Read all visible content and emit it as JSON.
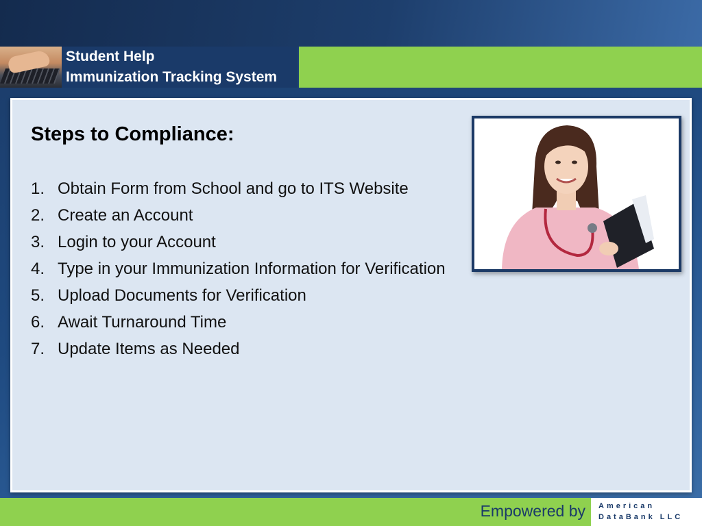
{
  "header": {
    "title_line1": "Student Help",
    "title_line2": "Immunization Tracking System",
    "image_icon": "typing-hands-image"
  },
  "content": {
    "heading": "Steps to Compliance:",
    "steps": [
      {
        "num": "1.",
        "text": "Obtain Form from School and go to ITS Website"
      },
      {
        "num": "2.",
        "text": "Create an Account"
      },
      {
        "num": "3.",
        "text": "Login to your Account"
      },
      {
        "num": "4.",
        "text": "Type in your Immunization Information for Verification"
      },
      {
        "num": "5.",
        "text": "Upload Documents for Verification"
      },
      {
        "num": "6.",
        "text": "Await Turnaround Time"
      },
      {
        "num": "7.",
        "text": "Update Items as Needed"
      }
    ],
    "photo_icon": "nurse-photo"
  },
  "footer": {
    "empowered": "Empowered by",
    "logo_line1": "American",
    "logo_line2": "DataBank LLC"
  },
  "colors": {
    "navy": "#1a3a69",
    "green": "#8fd14f",
    "panel": "#dce6f2"
  }
}
